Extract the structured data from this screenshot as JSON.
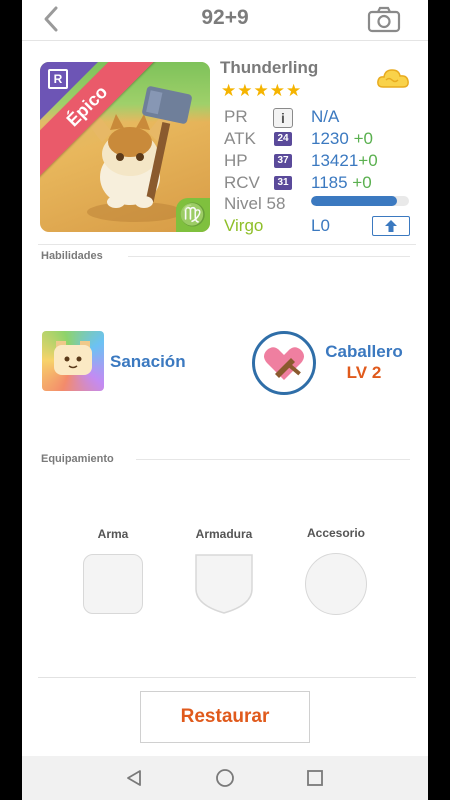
{
  "header": {
    "title": "92+9",
    "back_icon": "chevron-left-icon",
    "camera_icon": "camera-icon"
  },
  "hero": {
    "rarity": "Épico",
    "rarity_badge": "R",
    "zodiac_symbol": "♍",
    "name": "Thunderling",
    "stars": "★★★★★",
    "star_count": 5,
    "stats": {
      "pr_label": "PR",
      "pr_value": "N/A",
      "info_label": "i",
      "atk_label": "ATK",
      "atk_badge": "24",
      "atk_value": "1230",
      "atk_bonus": "+0",
      "hp_label": "HP",
      "hp_badge": "37",
      "hp_value": "13421",
      "hp_bonus": "+0",
      "rcv_label": "RCV",
      "rcv_badge": "31",
      "rcv_value": "1185",
      "rcv_bonus": "+0"
    },
    "level_label": "Nivel 58",
    "xp_progress": 0.88,
    "sign": "Virgo",
    "limit": "L0"
  },
  "skills": {
    "title": "Habilidades",
    "items": [
      {
        "name": "Sanación"
      },
      {
        "name": "Caballero",
        "level": "LV 2"
      }
    ]
  },
  "equipment": {
    "title": "Equipamiento",
    "slots": [
      {
        "label": "Arma"
      },
      {
        "label": "Armadura"
      },
      {
        "label": "Accesorio"
      }
    ]
  },
  "actions": {
    "restore_label": "Restaurar"
  },
  "colors": {
    "accent_blue": "#3b79c0",
    "accent_orange": "#e05a1c",
    "bonus_green": "#5ab04f",
    "star": "#f5b400"
  }
}
